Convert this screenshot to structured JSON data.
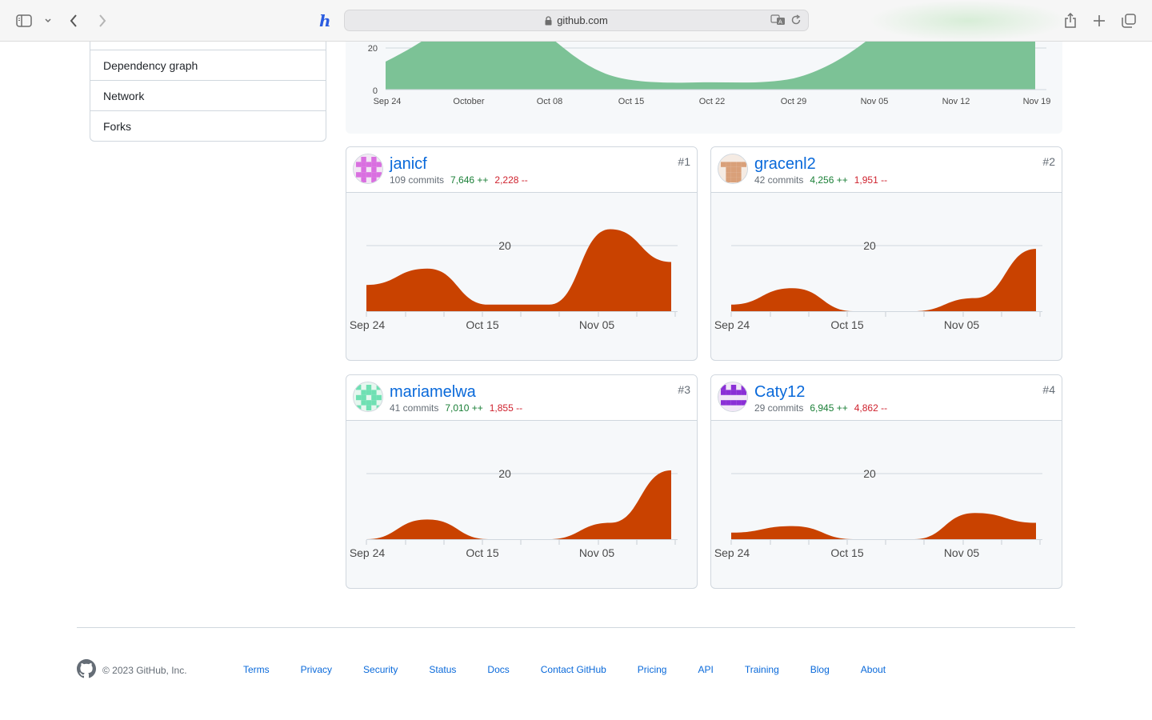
{
  "browser": {
    "url": "github.com",
    "colors": {
      "accent": "#2b5ce0"
    }
  },
  "sidebar": {
    "items": [
      {
        "label": "Dependency graph"
      },
      {
        "label": "Network"
      },
      {
        "label": "Forks"
      }
    ]
  },
  "main_chart": {
    "y_ticks": [
      "20",
      "0"
    ],
    "x_ticks": [
      "Sep 24",
      "October",
      "Oct 08",
      "Oct 15",
      "Oct 22",
      "Oct 29",
      "Nov 05",
      "Nov 12",
      "Nov 19"
    ],
    "color": "#7cc296"
  },
  "contributors": [
    {
      "rank": "#1",
      "username": "janicf",
      "commits": "109 commits",
      "additions": "7,646 ++",
      "deletions": "2,228 --"
    },
    {
      "rank": "#2",
      "username": "gracenl2",
      "commits": "42 commits",
      "additions": "4,256 ++",
      "deletions": "1,951 --"
    },
    {
      "rank": "#3",
      "username": "mariamelwa",
      "commits": "41 commits",
      "additions": "7,010 ++",
      "deletions": "1,855 --"
    },
    {
      "rank": "#4",
      "username": "Caty12",
      "commits": "29 commits",
      "additions": "6,945 ++",
      "deletions": "4,862 --"
    }
  ],
  "card_chart": {
    "y_tick": "20",
    "x_ticks": [
      "Sep 24",
      "Oct 15",
      "Nov 05"
    ],
    "color": "#c94200"
  },
  "chart_data": [
    {
      "type": "area",
      "title": "",
      "x": [
        "Sep 24",
        "October",
        "Oct 08",
        "Oct 15",
        "Oct 22",
        "Oct 29",
        "Nov 05",
        "Nov 12",
        "Nov 19"
      ],
      "series": [
        {
          "values": [
            13,
            24,
            23,
            3,
            3,
            3,
            20,
            30,
            30
          ]
        }
      ],
      "ylim": [
        0,
        20
      ]
    },
    {
      "type": "area",
      "x": [
        "Sep 24",
        "Oct 15",
        "Nov 05"
      ],
      "series": [
        {
          "name": "janicf",
          "values": [
            8,
            13,
            2,
            2,
            25,
            15
          ]
        }
      ],
      "ylim": [
        0,
        20
      ]
    },
    {
      "type": "area",
      "x": [
        "Sep 24",
        "Oct 15",
        "Nov 05"
      ],
      "series": [
        {
          "name": "gracenl2",
          "values": [
            2,
            7,
            0,
            0,
            4,
            19
          ]
        }
      ],
      "ylim": [
        0,
        20
      ]
    },
    {
      "type": "area",
      "x": [
        "Sep 24",
        "Oct 15",
        "Nov 05"
      ],
      "series": [
        {
          "name": "mariamelwa",
          "values": [
            0,
            6,
            0,
            0,
            5,
            21
          ]
        }
      ],
      "ylim": [
        0,
        20
      ]
    },
    {
      "type": "area",
      "x": [
        "Sep 24",
        "Oct 15",
        "Nov 05"
      ],
      "series": [
        {
          "name": "Caty12",
          "values": [
            2,
            4,
            0,
            0,
            8,
            5
          ]
        }
      ],
      "ylim": [
        0,
        20
      ]
    }
  ],
  "footer": {
    "copyright": "© 2023 GitHub, Inc.",
    "links": [
      "Terms",
      "Privacy",
      "Security",
      "Status",
      "Docs",
      "Contact GitHub",
      "Pricing",
      "API",
      "Training",
      "Blog",
      "About"
    ]
  }
}
